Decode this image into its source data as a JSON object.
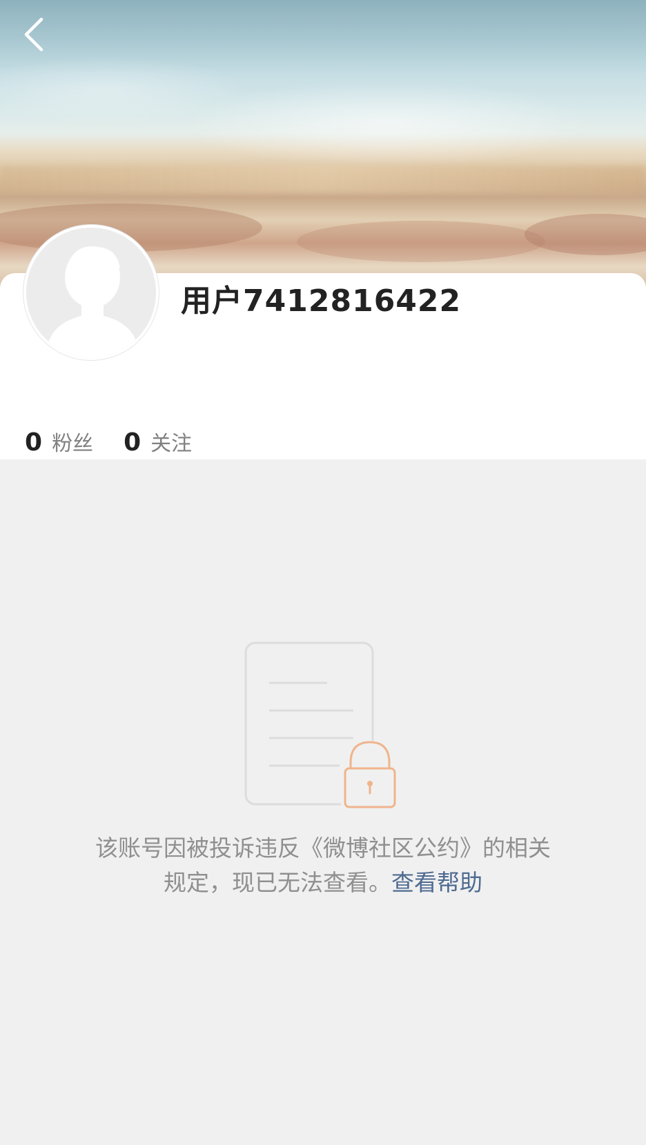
{
  "header": {
    "back_icon": "chevron-left-icon"
  },
  "profile": {
    "username": "用户7412816422",
    "avatar_icon": "default-avatar-icon",
    "stats": [
      {
        "value": "0",
        "label": "粉丝"
      },
      {
        "value": "0",
        "label": "关注"
      }
    ]
  },
  "notice": {
    "icon": "locked-document-icon",
    "line1": "该账号因被投诉违反《微博社区公约》的相关",
    "line2": "规定，现已无法查看。",
    "help_link": "查看帮助"
  },
  "colors": {
    "link": "#4e6a91",
    "lock": "#f0b48c",
    "background": "#f0f0f0",
    "text_muted": "#8f8f8f"
  }
}
